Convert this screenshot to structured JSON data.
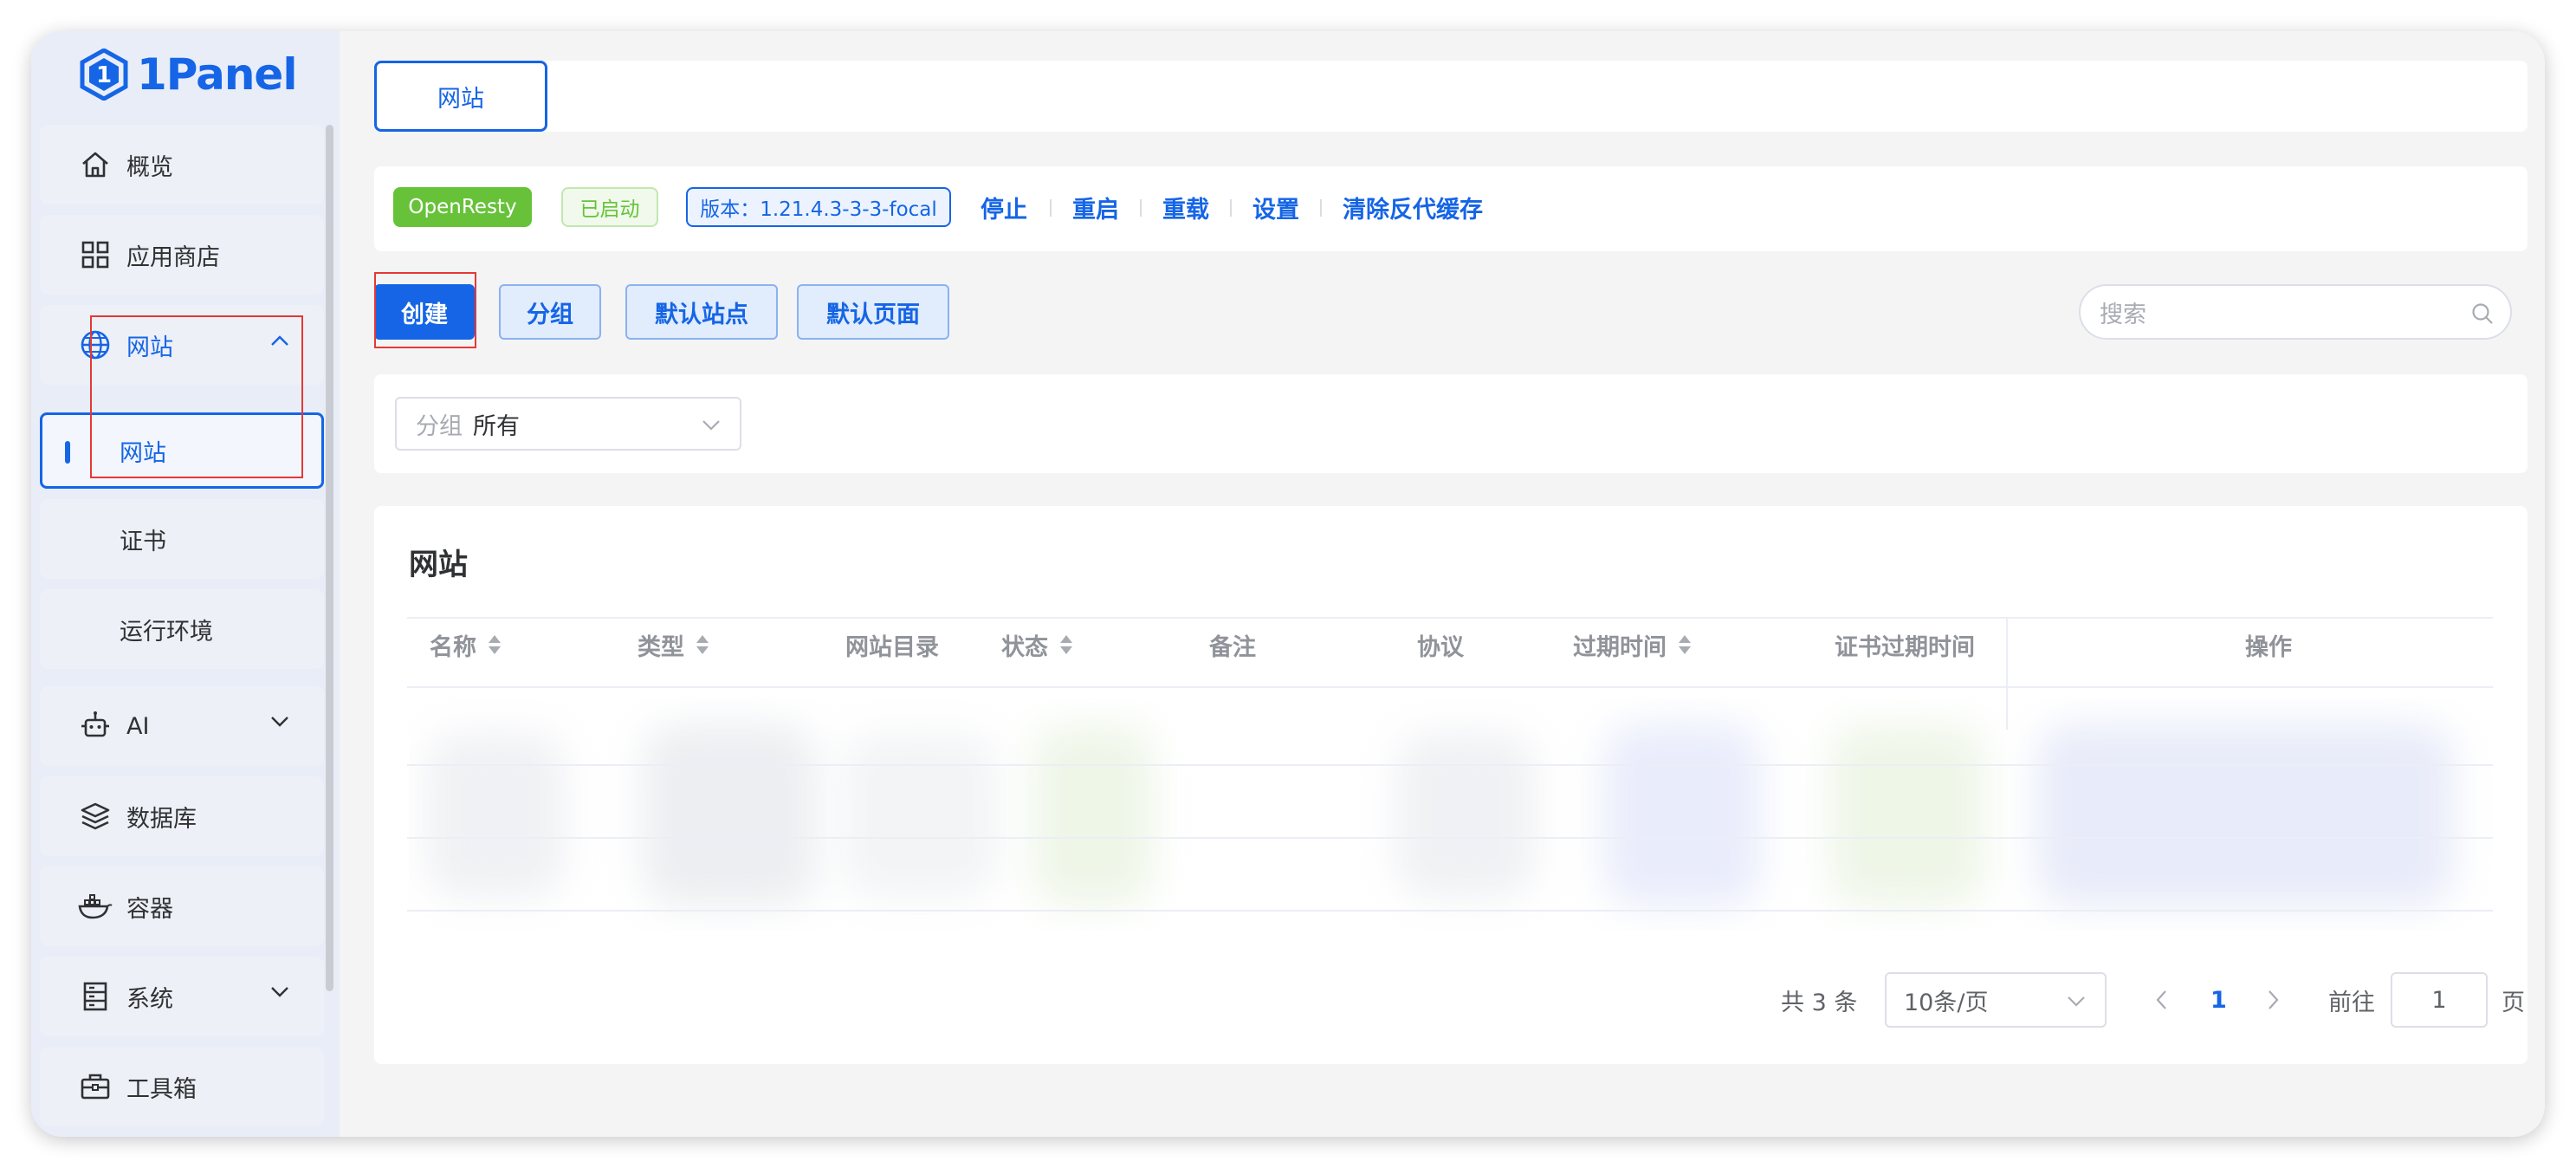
{
  "brand": {
    "logo_text": "1Panel"
  },
  "sidebar": {
    "items": [
      {
        "label": "概览",
        "icon": "home-icon"
      },
      {
        "label": "应用商店",
        "icon": "apps-grid-icon"
      },
      {
        "label": "网站",
        "icon": "globe-icon",
        "expanded": true
      },
      {
        "label": "AI",
        "icon": "robot-icon"
      },
      {
        "label": "数据库",
        "icon": "layers-icon"
      },
      {
        "label": "容器",
        "icon": "docker-icon"
      },
      {
        "label": "系统",
        "icon": "server-icon"
      },
      {
        "label": "工具箱",
        "icon": "toolbox-icon"
      }
    ],
    "submenu": [
      {
        "label": "网站",
        "active": true
      },
      {
        "label": "证书"
      },
      {
        "label": "运行环境"
      }
    ]
  },
  "tabs": {
    "active_label": "网站"
  },
  "status_bar": {
    "app_name": "OpenResty",
    "state": "已启动",
    "version": "版本：1.21.4.3-3-3-focal",
    "actions": [
      "停止",
      "重启",
      "重载",
      "设置",
      "清除反代缓存"
    ]
  },
  "toolbar": {
    "create_label": "创建",
    "group_label": "分组",
    "default_site_label": "默认站点",
    "default_page_label": "默认页面",
    "search_placeholder": "搜索"
  },
  "filter": {
    "group_prefix": "分组",
    "group_value": "所有"
  },
  "table": {
    "title": "网站",
    "columns": [
      "名称",
      "类型",
      "网站目录",
      "状态",
      "备注",
      "协议",
      "过期时间",
      "证书过期时间",
      "操作"
    ]
  },
  "pagination": {
    "total_text": "共 3 条",
    "page_size": "10条/页",
    "current_page": "1",
    "goto_label": "前往",
    "goto_value": "1",
    "page_suffix": "页"
  },
  "colors": {
    "primary": "#1565e6",
    "openresty_tag": "#67c23a",
    "running_tag_bg": "#f0f9eb",
    "annotation_red": "#e53935"
  }
}
